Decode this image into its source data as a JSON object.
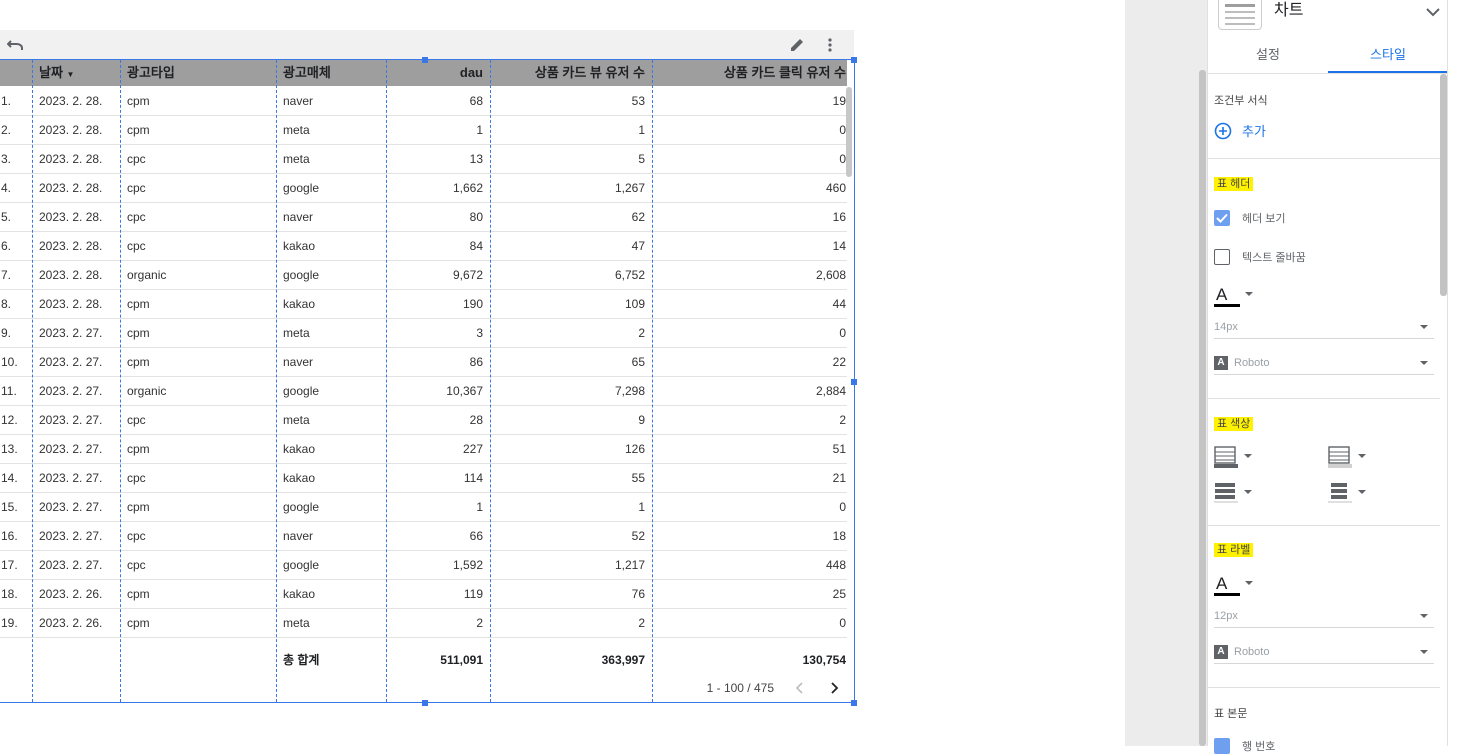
{
  "table": {
    "columns": [
      {
        "key": "idx",
        "label": ""
      },
      {
        "key": "date",
        "label": "날짜"
      },
      {
        "key": "ad_type",
        "label": "광고타입"
      },
      {
        "key": "media",
        "label": "광고매체"
      },
      {
        "key": "dau",
        "label": "dau"
      },
      {
        "key": "view_users",
        "label": "상품 카드 뷰 유저 수"
      },
      {
        "key": "click_users",
        "label": "상품 카드 클릭 유저 수"
      }
    ],
    "rows": [
      [
        "1.",
        "2023. 2. 28.",
        "cpm",
        "naver",
        "68",
        "53",
        "19"
      ],
      [
        "2.",
        "2023. 2. 28.",
        "cpm",
        "meta",
        "1",
        "1",
        "0"
      ],
      [
        "3.",
        "2023. 2. 28.",
        "cpc",
        "meta",
        "13",
        "5",
        "0"
      ],
      [
        "4.",
        "2023. 2. 28.",
        "cpc",
        "google",
        "1,662",
        "1,267",
        "460"
      ],
      [
        "5.",
        "2023. 2. 28.",
        "cpc",
        "naver",
        "80",
        "62",
        "16"
      ],
      [
        "6.",
        "2023. 2. 28.",
        "cpc",
        "kakao",
        "84",
        "47",
        "14"
      ],
      [
        "7.",
        "2023. 2. 28.",
        "organic",
        "google",
        "9,672",
        "6,752",
        "2,608"
      ],
      [
        "8.",
        "2023. 2. 28.",
        "cpm",
        "kakao",
        "190",
        "109",
        "44"
      ],
      [
        "9.",
        "2023. 2. 27.",
        "cpm",
        "meta",
        "3",
        "2",
        "0"
      ],
      [
        "10.",
        "2023. 2. 27.",
        "cpm",
        "naver",
        "86",
        "65",
        "22"
      ],
      [
        "11.",
        "2023. 2. 27.",
        "organic",
        "google",
        "10,367",
        "7,298",
        "2,884"
      ],
      [
        "12.",
        "2023. 2. 27.",
        "cpc",
        "meta",
        "28",
        "9",
        "2"
      ],
      [
        "13.",
        "2023. 2. 27.",
        "cpm",
        "kakao",
        "227",
        "126",
        "51"
      ],
      [
        "14.",
        "2023. 2. 27.",
        "cpc",
        "kakao",
        "114",
        "55",
        "21"
      ],
      [
        "15.",
        "2023. 2. 27.",
        "cpm",
        "google",
        "1",
        "1",
        "0"
      ],
      [
        "16.",
        "2023. 2. 27.",
        "cpc",
        "naver",
        "66",
        "52",
        "18"
      ],
      [
        "17.",
        "2023. 2. 27.",
        "cpc",
        "google",
        "1,592",
        "1,217",
        "448"
      ],
      [
        "18.",
        "2023. 2. 26.",
        "cpm",
        "kakao",
        "119",
        "76",
        "25"
      ],
      [
        "19.",
        "2023. 2. 26.",
        "cpm",
        "meta",
        "2",
        "2",
        "0"
      ]
    ],
    "totals": {
      "label": "총 합계",
      "dau": "511,091",
      "view_users": "363,997",
      "click_users": "130,754"
    },
    "pagination": {
      "range": "1 - 100 / 475"
    }
  },
  "panel": {
    "chart_title": "차트",
    "tabs": [
      {
        "label": "설정"
      },
      {
        "label": "스타일"
      }
    ],
    "conditional_format": {
      "label": "조건부 서식",
      "add": "추가"
    },
    "table_header": {
      "label": "표 헤더",
      "show_header": "헤더 보기",
      "wrap_text": "텍스트 줄바꿈",
      "font_size": "14px",
      "font_family": "Roboto"
    },
    "table_colors": {
      "label": "표 색상"
    },
    "table_labels": {
      "label": "표 라벨",
      "font_size": "12px",
      "font_family": "Roboto"
    },
    "table_body": {
      "label": "표 본문",
      "row_numbers": "행 번호"
    }
  },
  "colors": {
    "accent": "#1a73e8",
    "selection": "#3b78e7",
    "highlight": "#fff200",
    "header_bg": "#9e9e9e"
  }
}
